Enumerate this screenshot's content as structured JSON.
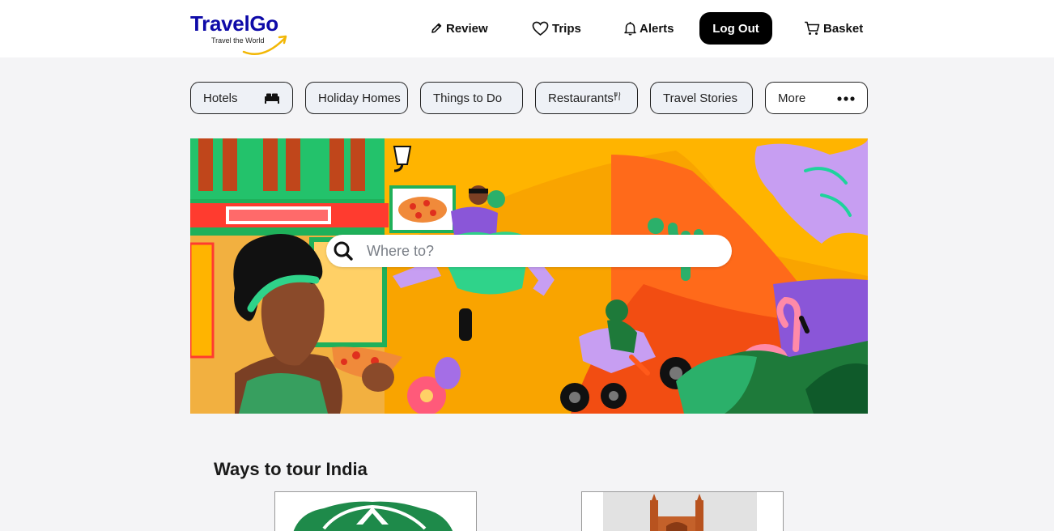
{
  "brand": {
    "name": "TravelGo",
    "tagline": "Travel the World",
    "primary_color": "#0e0aa8",
    "swoosh_color": "#f2b705"
  },
  "nav": {
    "items": [
      {
        "label": "Review",
        "icon": "pencil-icon"
      },
      {
        "label": "Trips",
        "icon": "heart-icon"
      },
      {
        "label": "Alerts",
        "icon": "bell-icon"
      },
      {
        "label": "Basket",
        "icon": "cart-icon"
      }
    ],
    "logout_label": "Log Out"
  },
  "categories": [
    {
      "label": "Hotels",
      "icon": "bed-icon"
    },
    {
      "label": "Holiday Homes",
      "icon": ""
    },
    {
      "label": "Things to Do",
      "icon": ""
    },
    {
      "label": "Restaurants",
      "icon": "fork-knife-icon"
    },
    {
      "label": "Travel Stories",
      "icon": ""
    },
    {
      "label": "More",
      "icon": "more-dots-icon"
    }
  ],
  "search": {
    "placeholder": "Where to?",
    "value": ""
  },
  "section": {
    "title": "Ways to tour India"
  }
}
